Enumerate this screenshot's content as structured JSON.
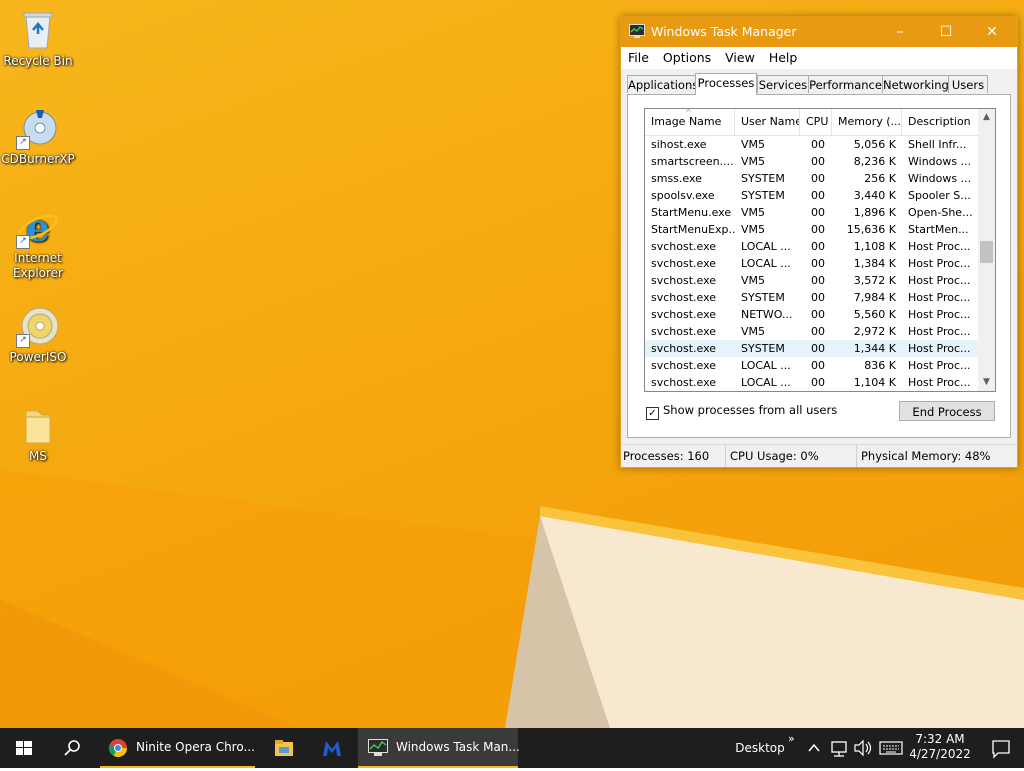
{
  "desktop": {
    "icons": [
      {
        "label": "Recycle Bin"
      },
      {
        "label": "CDBurnerXP"
      },
      {
        "label": "Internet Explorer"
      },
      {
        "label": "PowerISO"
      },
      {
        "label": "MS"
      }
    ]
  },
  "window": {
    "title": "Windows Task Manager",
    "controls": {
      "minimize": "–",
      "maximize": "☐",
      "close": "✕"
    },
    "menu": [
      "File",
      "Options",
      "View",
      "Help"
    ],
    "tabs": [
      "Applications",
      "Processes",
      "Services",
      "Performance",
      "Networking",
      "Users"
    ],
    "active_tab": "Processes",
    "columns": [
      "Image Name",
      "User Name",
      "CPU",
      "Memory (...",
      "Description"
    ],
    "processes": [
      {
        "name": "sihost.exe",
        "user": "VM5",
        "cpu": "00",
        "mem": "5,056 K",
        "desc": "Shell Infr..."
      },
      {
        "name": "smartscreen....",
        "user": "VM5",
        "cpu": "00",
        "mem": "8,236 K",
        "desc": "Windows ..."
      },
      {
        "name": "smss.exe",
        "user": "SYSTEM",
        "cpu": "00",
        "mem": "256 K",
        "desc": "Windows ..."
      },
      {
        "name": "spoolsv.exe",
        "user": "SYSTEM",
        "cpu": "00",
        "mem": "3,440 K",
        "desc": "Spooler S..."
      },
      {
        "name": "StartMenu.exe",
        "user": "VM5",
        "cpu": "00",
        "mem": "1,896 K",
        "desc": "Open-She..."
      },
      {
        "name": "StartMenuExp...",
        "user": "VM5",
        "cpu": "00",
        "mem": "15,636 K",
        "desc": "StartMen..."
      },
      {
        "name": "svchost.exe",
        "user": "LOCAL ...",
        "cpu": "00",
        "mem": "1,108 K",
        "desc": "Host Proc..."
      },
      {
        "name": "svchost.exe",
        "user": "LOCAL ...",
        "cpu": "00",
        "mem": "1,384 K",
        "desc": "Host Proc..."
      },
      {
        "name": "svchost.exe",
        "user": "VM5",
        "cpu": "00",
        "mem": "3,572 K",
        "desc": "Host Proc..."
      },
      {
        "name": "svchost.exe",
        "user": "SYSTEM",
        "cpu": "00",
        "mem": "7,984 K",
        "desc": "Host Proc..."
      },
      {
        "name": "svchost.exe",
        "user": "NETWO...",
        "cpu": "00",
        "mem": "5,560 K",
        "desc": "Host Proc..."
      },
      {
        "name": "svchost.exe",
        "user": "VM5",
        "cpu": "00",
        "mem": "2,972 K",
        "desc": "Host Proc..."
      },
      {
        "name": "svchost.exe",
        "user": "SYSTEM",
        "cpu": "00",
        "mem": "1,344 K",
        "desc": "Host Proc...",
        "selected": true
      },
      {
        "name": "svchost.exe",
        "user": "LOCAL ...",
        "cpu": "00",
        "mem": "836 K",
        "desc": "Host Proc..."
      },
      {
        "name": "svchost.exe",
        "user": "LOCAL ...",
        "cpu": "00",
        "mem": "1,104 K",
        "desc": "Host Proc..."
      }
    ],
    "show_all_users_label": "Show processes from all users",
    "show_all_users_checked": true,
    "end_process_label": "End Process",
    "status": {
      "processes": "Processes: 160",
      "cpu": "CPU Usage: 0%",
      "memory": "Physical Memory: 48%"
    }
  },
  "taskbar": {
    "apps": [
      {
        "label": "Ninite Opera Chro..."
      },
      {
        "label": "Windows Task Man..."
      }
    ],
    "desktop_label": "Desktop",
    "chevron": "»",
    "time": "7:32 AM",
    "date": "4/27/2022"
  },
  "colors": {
    "accent": "#e99a13",
    "desktop": "#f5a80f",
    "taskbar": "#1e1e1e"
  }
}
